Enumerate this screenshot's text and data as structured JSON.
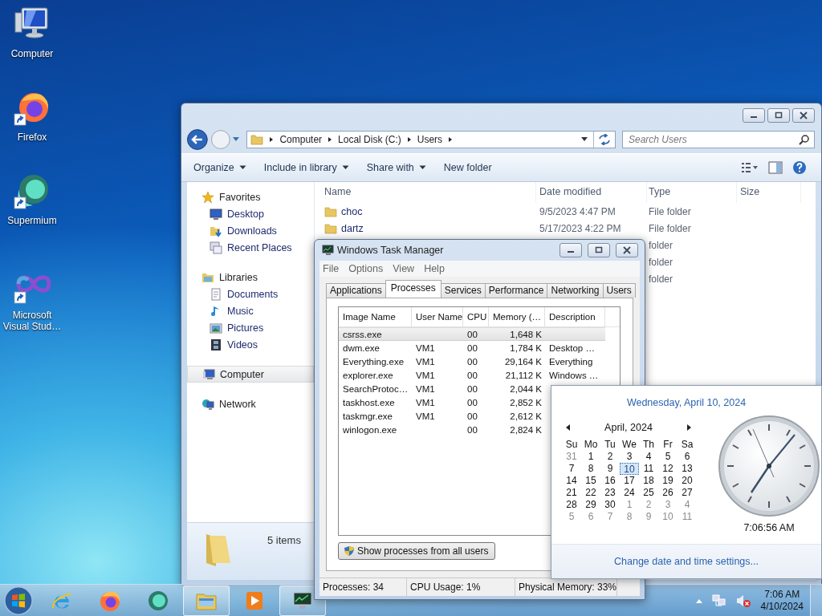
{
  "desktop_icons": [
    {
      "label": "Computer",
      "kind": "computer",
      "shortcut": false
    },
    {
      "label": "Firefox",
      "kind": "firefox",
      "shortcut": true
    },
    {
      "label": "Supermium",
      "kind": "supermium",
      "shortcut": true
    },
    {
      "label": "Microsoft Visual Stud…",
      "kind": "vstudio",
      "shortcut": true
    }
  ],
  "explorer": {
    "breadcrumb": [
      "Computer",
      "Local Disk (C:)",
      "Users"
    ],
    "search": {
      "placeholder": "Search Users"
    },
    "toolbar": [
      {
        "label": "Organize",
        "dropdown": true
      },
      {
        "label": "Include in library",
        "dropdown": true
      },
      {
        "label": "Share with",
        "dropdown": true
      },
      {
        "label": "New folder",
        "dropdown": false
      }
    ],
    "nav": [
      {
        "label": "Favorites",
        "kind": "favorites",
        "selected": false,
        "children": [
          {
            "label": "Desktop",
            "kind": "desktop",
            "selected": false
          },
          {
            "label": "Downloads",
            "kind": "downloads",
            "selected": false
          },
          {
            "label": "Recent Places",
            "kind": "recent",
            "selected": false
          }
        ]
      },
      {
        "label": "Libraries",
        "kind": "libraries",
        "selected": false,
        "children": [
          {
            "label": "Documents",
            "kind": "documents",
            "selected": false
          },
          {
            "label": "Music",
            "kind": "music",
            "selected": false
          },
          {
            "label": "Pictures",
            "kind": "pictures",
            "selected": false
          },
          {
            "label": "Videos",
            "kind": "videos",
            "selected": false
          }
        ]
      },
      {
        "label": "Computer",
        "kind": "computer",
        "selected": true
      },
      {
        "label": "Network",
        "kind": "network",
        "selected": false
      }
    ],
    "columns": [
      "Name",
      "Date modified",
      "Type",
      "Size"
    ],
    "rows": [
      {
        "name": "choc",
        "date": "9/5/2023 4:47 PM",
        "type": "File folder"
      },
      {
        "name": "dartz",
        "date": "5/17/2023 4:22 PM",
        "type": "File folder"
      },
      {
        "type": "folder"
      },
      {
        "type": "folder"
      },
      {
        "type": "folder"
      }
    ],
    "status": "5 items"
  },
  "task_manager": {
    "title": "Windows Task Manager",
    "menu": [
      "File",
      "Options",
      "View",
      "Help"
    ],
    "tabs": [
      {
        "label": "Applications",
        "selected": false
      },
      {
        "label": "Processes",
        "selected": true
      },
      {
        "label": "Services",
        "selected": false
      },
      {
        "label": "Performance",
        "selected": false
      },
      {
        "label": "Networking",
        "selected": false
      },
      {
        "label": "Users",
        "selected": false
      }
    ],
    "columns": [
      "Image Name",
      "User Name",
      "CPU",
      "Memory (…",
      "Description"
    ],
    "rows": [
      {
        "image": "csrss.exe",
        "user": "",
        "cpu": "00",
        "memory": "1,648 K",
        "description": "",
        "selected": true
      },
      {
        "image": "dwm.exe",
        "user": "VM1",
        "cpu": "00",
        "memory": "1,784 K",
        "description": "Desktop …",
        "selected": false
      },
      {
        "image": "Everything.exe",
        "user": "VM1",
        "cpu": "00",
        "memory": "29,164 K",
        "description": "Everything",
        "selected": false
      },
      {
        "image": "explorer.exe",
        "user": "VM1",
        "cpu": "00",
        "memory": "21,112 K",
        "description": "Windows …",
        "selected": false
      },
      {
        "image": "SearchProtoc…",
        "user": "VM1",
        "cpu": "00",
        "memory": "2,044 K",
        "description": "",
        "selected": false
      },
      {
        "image": "taskhost.exe",
        "user": "VM1",
        "cpu": "00",
        "memory": "2,852 K",
        "description": "",
        "selected": false
      },
      {
        "image": "taskmgr.exe",
        "user": "VM1",
        "cpu": "00",
        "memory": "2,612 K",
        "description": "",
        "selected": false
      },
      {
        "image": "winlogon.exe",
        "user": "",
        "cpu": "00",
        "memory": "2,824 K",
        "description": "",
        "selected": false
      }
    ],
    "show_all_button": "Show processes from all users",
    "status": [
      "Processes: 34",
      "CPU Usage: 1%",
      "Physical Memory: 33%"
    ]
  },
  "calendar": {
    "date_header": "Wednesday, April 10, 2024",
    "month": "April, 2024",
    "weekdays": [
      "Su",
      "Mo",
      "Tu",
      "We",
      "Th",
      "Fr",
      "Sa"
    ],
    "weeks": [
      [
        {
          "d": "31",
          "other": true,
          "selected": false
        },
        {
          "d": "1",
          "other": false,
          "selected": false
        },
        {
          "d": "2",
          "other": false,
          "selected": false
        },
        {
          "d": "3",
          "other": false,
          "selected": false
        },
        {
          "d": "4",
          "other": false,
          "selected": false
        },
        {
          "d": "5",
          "other": false,
          "selected": false
        },
        {
          "d": "6",
          "other": false,
          "selected": false
        }
      ],
      [
        {
          "d": "7",
          "other": false,
          "selected": false
        },
        {
          "d": "8",
          "other": false,
          "selected": false
        },
        {
          "d": "9",
          "other": false,
          "selected": false
        },
        {
          "d": "10",
          "other": false,
          "selected": true
        },
        {
          "d": "11",
          "other": false,
          "selected": false
        },
        {
          "d": "12",
          "other": false,
          "selected": false
        },
        {
          "d": "13",
          "other": false,
          "selected": false
        }
      ],
      [
        {
          "d": "14",
          "other": false,
          "selected": false
        },
        {
          "d": "15",
          "other": false,
          "selected": false
        },
        {
          "d": "16",
          "other": false,
          "selected": false
        },
        {
          "d": "17",
          "other": false,
          "selected": false
        },
        {
          "d": "18",
          "other": false,
          "selected": false
        },
        {
          "d": "19",
          "other": false,
          "selected": false
        },
        {
          "d": "20",
          "other": false,
          "selected": false
        }
      ],
      [
        {
          "d": "21",
          "other": false,
          "selected": false
        },
        {
          "d": "22",
          "other": false,
          "selected": false
        },
        {
          "d": "23",
          "other": false,
          "selected": false
        },
        {
          "d": "24",
          "other": false,
          "selected": false
        },
        {
          "d": "25",
          "other": false,
          "selected": false
        },
        {
          "d": "26",
          "other": false,
          "selected": false
        },
        {
          "d": "27",
          "other": false,
          "selected": false
        }
      ],
      [
        {
          "d": "28",
          "other": false,
          "selected": false
        },
        {
          "d": "29",
          "other": false,
          "selected": false
        },
        {
          "d": "30",
          "other": false,
          "selected": false
        },
        {
          "d": "1",
          "other": true,
          "selected": false
        },
        {
          "d": "2",
          "other": true,
          "selected": false
        },
        {
          "d": "3",
          "other": true,
          "selected": false
        },
        {
          "d": "4",
          "other": true,
          "selected": false
        }
      ],
      [
        {
          "d": "5",
          "other": true,
          "selected": false
        },
        {
          "d": "6",
          "other": true,
          "selected": false
        },
        {
          "d": "7",
          "other": true,
          "selected": false
        },
        {
          "d": "8",
          "other": true,
          "selected": false
        },
        {
          "d": "9",
          "other": true,
          "selected": false
        },
        {
          "d": "10",
          "other": true,
          "selected": false
        },
        {
          "d": "11",
          "other": true,
          "selected": false
        }
      ]
    ],
    "clock_time": "7:06:56 AM",
    "settings_link": "Change date and time settings..."
  },
  "taskbar": {
    "apps": [
      {
        "kind": "ie",
        "running": false
      },
      {
        "kind": "firefox",
        "running": false
      },
      {
        "kind": "supermium",
        "running": false
      },
      {
        "kind": "explorer",
        "running": true
      },
      {
        "kind": "media",
        "running": false
      },
      {
        "kind": "taskmgr",
        "running": true
      }
    ],
    "time": "7:06 AM",
    "date": "4/10/2024"
  }
}
